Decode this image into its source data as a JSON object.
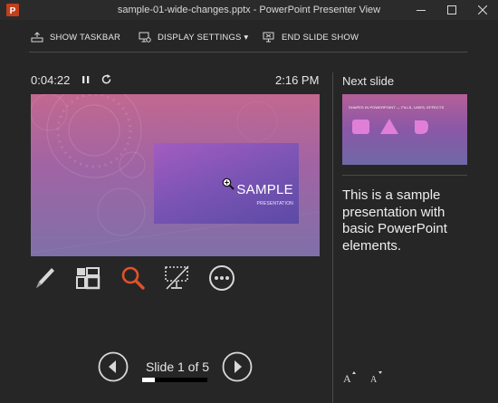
{
  "window": {
    "title": "sample-01-wide-changes.pptx - PowerPoint Presenter View",
    "app_icon": "powerpoint-icon",
    "app_icon_letter": "P"
  },
  "toolbar": {
    "show_taskbar": "SHOW TASKBAR",
    "display_settings": "DISPLAY SETTINGS ▾",
    "end_slide_show": "END SLIDE SHOW"
  },
  "timer": {
    "elapsed": "0:04:22",
    "clock": "2:16 PM"
  },
  "current_slide": {
    "title": "SAMPLE",
    "subtitle": "PRESENTATION"
  },
  "tools": [
    "pen-icon",
    "slide-grid-icon",
    "zoom-icon",
    "black-screen-icon",
    "more-options-icon"
  ],
  "navigation": {
    "slide_counter": "Slide 1 of 5",
    "progress_fraction": 0.2
  },
  "next_slide": {
    "label": "Next slide",
    "thumb_title": "SHAPES IN POWERPOINT — FILLS, LINES, EFFECTS"
  },
  "notes": {
    "text": "This is a sample presentation with basic PowerPoint elements."
  },
  "colors": {
    "background": "#262626",
    "accent_zoom": "#e0522a",
    "app_icon": "#c43e1c"
  }
}
